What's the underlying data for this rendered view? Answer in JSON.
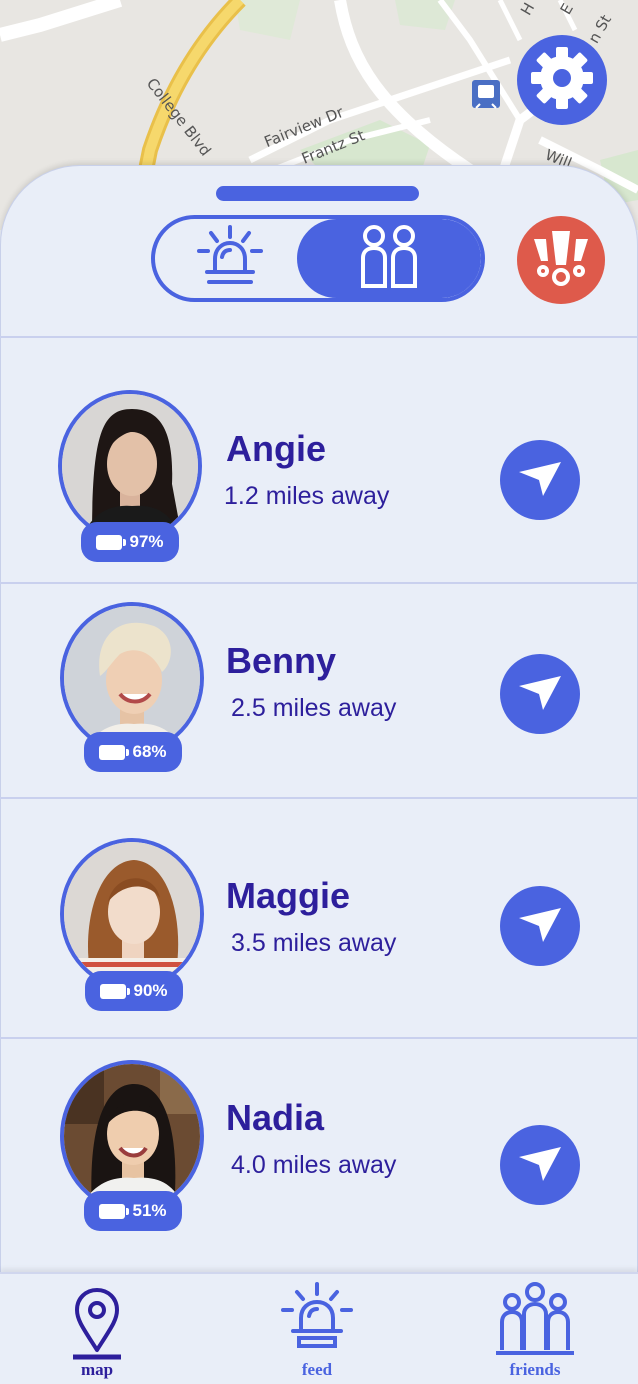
{
  "map": {
    "street_labels": [
      "College Blvd",
      "Fairview Dr",
      "Frantz St",
      "Will",
      "n St",
      "H",
      "E"
    ]
  },
  "header": {
    "settings_icon": "gear-icon",
    "alert_toggle_icon": "siren-icon",
    "friends_toggle_icon": "people-icon",
    "sos_icon": "exclamation-alert-icon",
    "accent_color": "#4a63e0",
    "sos_color": "#de5a4b"
  },
  "friends": [
    {
      "name": "Angie",
      "distance": "1.2 miles away",
      "battery": "97%"
    },
    {
      "name": "Benny",
      "distance": "2.5 miles away",
      "battery": "68%"
    },
    {
      "name": "Maggie",
      "distance": "3.5 miles away",
      "battery": "90%"
    },
    {
      "name": "Nadia",
      "distance": "4.0 miles away",
      "battery": "51%"
    }
  ],
  "nav": {
    "map_label": "map",
    "feed_label": "feed",
    "friends_label": "friends"
  }
}
